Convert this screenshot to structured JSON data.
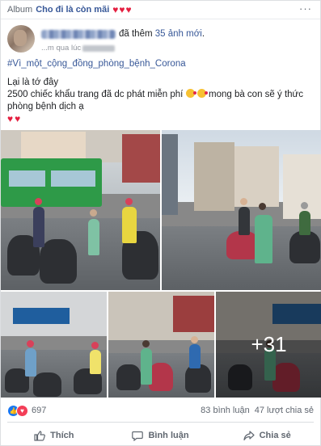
{
  "header": {
    "album_prefix": "Album",
    "album_name": "Cho đi là còn mãi",
    "album_hearts": "♥♥♥",
    "more_icon": "···"
  },
  "post": {
    "action_text": "đã thêm",
    "photo_count_text": "35 ảnh mới",
    "time_prefix": "...m qua lúc",
    "hashtag": "#Vì_một_cộng_đồng_phòng_bệnh_Corona",
    "lines": [
      "Lại là tớ đây",
      "2500 chiếc khẩu trang đã dc phát miễn phí",
      "mong bà con sẽ ý thức",
      "phòng bệnh dịch ạ"
    ],
    "hearts": "♥♥"
  },
  "gallery": {
    "more_overlay": "+31"
  },
  "reactions": {
    "count": "697",
    "comments": "83 bình luận",
    "shares": "47 lượt chia sẻ",
    "like_icon": "thumbs-up-icon",
    "love_icon": "heart-icon"
  },
  "actions": {
    "like": "Thích",
    "comment": "Bình luận",
    "share": "Chia sẻ"
  },
  "colors": {
    "link": "#385898",
    "heart": "#e41e3f",
    "like_blue": "#1877f2"
  }
}
